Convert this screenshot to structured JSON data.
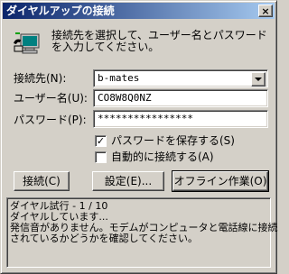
{
  "window": {
    "title": "ダイヤルアップの接続",
    "close_symbol": "×"
  },
  "instruction": "接続先を選択して、ユーザー名とパスワードを入力してください。",
  "form": {
    "destination_label": "接続先(N):",
    "destination_value": "b-mates",
    "username_label": "ユーザー名(U):",
    "username_value": "CO8W8Q0NZ",
    "password_label": "パスワード(P):",
    "password_value": "****************"
  },
  "options": {
    "save_password_label": "パスワードを保存する(S)",
    "save_password_checked": true,
    "auto_connect_label": "自動的に接続する(A)",
    "auto_connect_checked": false,
    "check_mark": "✓"
  },
  "buttons": {
    "connect": "接続(C)",
    "settings": "設定(E)...",
    "offline": "オフライン作業(O)"
  },
  "status": [
    "ダイヤル試行 - 1 / 10",
    "ダイヤルしています...",
    "発信音がありません。モデムがコンピュータと電話線に接続",
    "されているかどうかを確認してください。"
  ],
  "icons": {
    "dialup": "dialup-connection-icon"
  }
}
